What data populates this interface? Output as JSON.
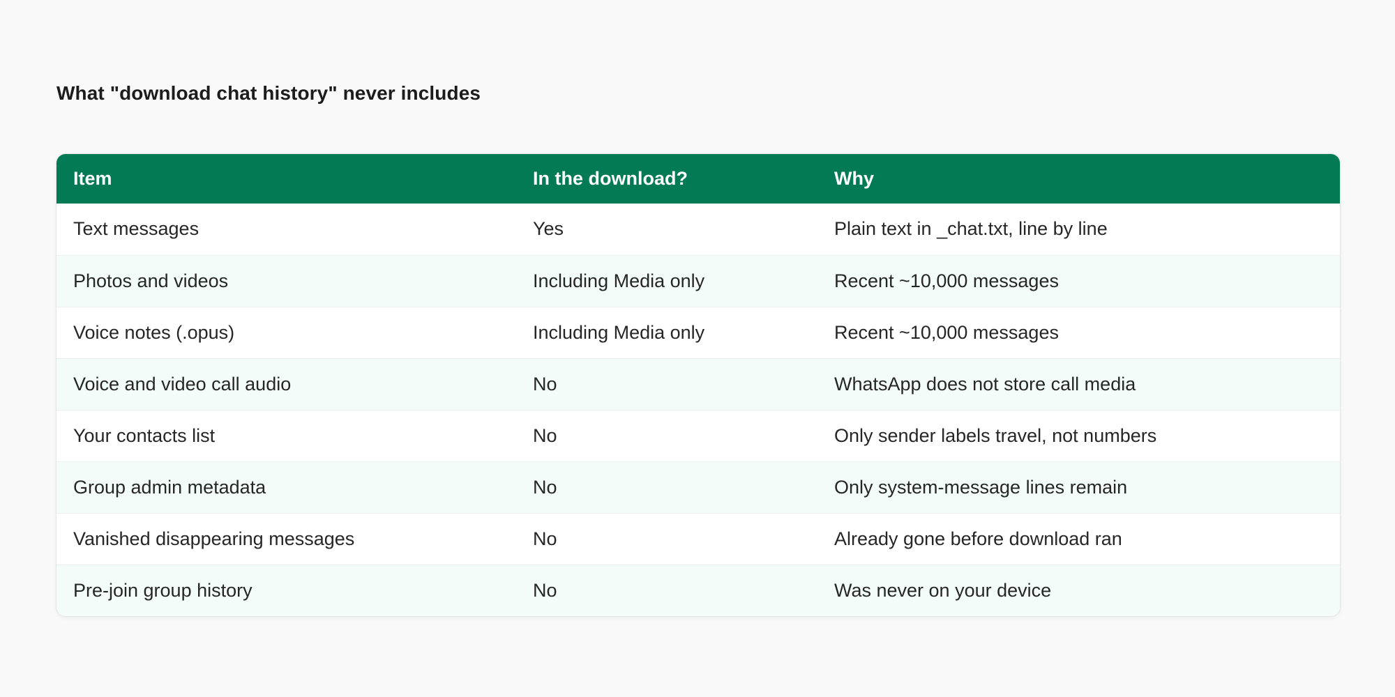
{
  "title": "What \"download chat history\" never includes",
  "table": {
    "headers": [
      "Item",
      "In the download?",
      "Why"
    ],
    "rows": [
      [
        "Text messages",
        "Yes",
        "Plain text in _chat.txt, line by line"
      ],
      [
        "Photos and videos",
        "Including Media only",
        "Recent ~10,000 messages"
      ],
      [
        "Voice notes (.opus)",
        "Including Media only",
        "Recent ~10,000 messages"
      ],
      [
        "Voice and video call audio",
        "No",
        "WhatsApp does not store call media"
      ],
      [
        "Your contacts list",
        "No",
        "Only sender labels travel, not numbers"
      ],
      [
        "Group admin metadata",
        "No",
        "Only system-message lines remain"
      ],
      [
        "Vanished disappearing messages",
        "No",
        "Already gone before download ran"
      ],
      [
        "Pre-join group history",
        "No",
        "Was never on your device"
      ]
    ]
  },
  "colors": {
    "header_bg": "#017a55",
    "alt_row_bg": "#f3fcf9",
    "page_bg": "#f9f9f9"
  }
}
